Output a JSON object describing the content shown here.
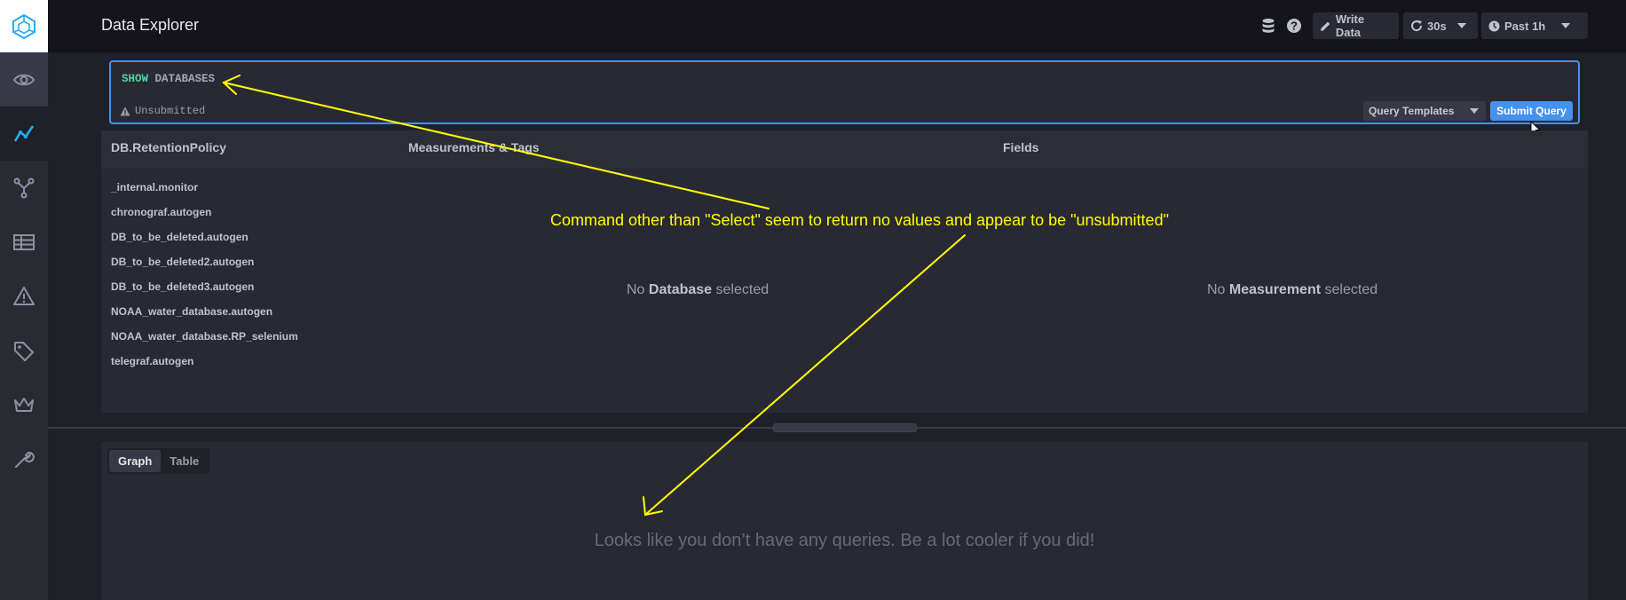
{
  "header": {
    "title": "Data Explorer",
    "write_data_label": "Write Data",
    "refresh_label": "30s",
    "time_range_label": "Past 1h"
  },
  "sidebar": {
    "items": [
      {
        "icon": "eye-icon"
      },
      {
        "icon": "data-explorer-icon"
      },
      {
        "icon": "branch-icon"
      },
      {
        "icon": "dashboard-grid-icon"
      },
      {
        "icon": "alert-icon"
      },
      {
        "icon": "tags-icon"
      },
      {
        "icon": "crown-icon"
      },
      {
        "icon": "wrench-icon"
      }
    ]
  },
  "editor": {
    "keyword": "SHOW",
    "query_rest": "DATABASES",
    "status": "Unsubmitted",
    "query_templates_label": "Query Templates",
    "submit_label": "Submit Query"
  },
  "schema": {
    "col_db": "DB.RetentionPolicy",
    "col_measurements": "Measurements & Tags",
    "col_fields": "Fields",
    "databases": [
      "_internal.monitor",
      "chronograf.autogen",
      "DB_to_be_deleted.autogen",
      "DB_to_be_deleted2.autogen",
      "DB_to_be_deleted3.autogen",
      "NOAA_water_database.autogen",
      "NOAA_water_database.RP_selenium",
      "telegraf.autogen"
    ],
    "no_db": {
      "prefix": "No",
      "strong": "Database",
      "suffix": "selected"
    },
    "no_measurement": {
      "prefix": "No",
      "strong": "Measurement",
      "suffix": "selected"
    }
  },
  "viz": {
    "tab_graph": "Graph",
    "tab_table": "Table",
    "empty_message": "Looks like you don’t have any queries. Be a lot cooler if you did!"
  },
  "annotation": {
    "text": "Command other than \"Select\" seem to return no values and appear to be \"unsubmitted\"",
    "color": "#ffff00"
  },
  "colors": {
    "accent": "#4591ed",
    "keyword": "#4ed8a0"
  }
}
